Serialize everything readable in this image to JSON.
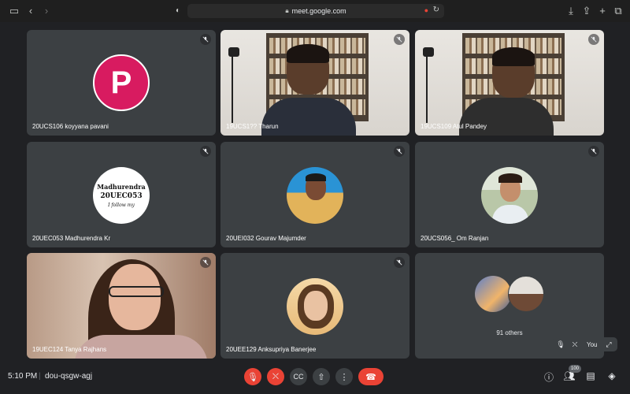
{
  "browser": {
    "url": "meet.google.com"
  },
  "tiles": [
    {
      "name": "20UCS106 koyyana pavani",
      "avatar_letter": "P",
      "avatar_color": "#d81b60",
      "muted": true
    },
    {
      "name": "19UCS1?? Tharun",
      "muted": true
    },
    {
      "name": "19UCS109 Atul Pandey",
      "muted": true
    },
    {
      "name": "20UEC053 Madhurendra Kr",
      "avatar_text": [
        "Madhurendra",
        "20UEC053",
        "I follow my"
      ],
      "muted": true
    },
    {
      "name": "20UEI032 Gourav Majumder",
      "muted": true
    },
    {
      "name": "20UCS056_ Om Ranjan",
      "muted": true
    },
    {
      "name": "19UEC124 Tanya Rajhans",
      "muted": true
    },
    {
      "name": "20UEE129 Anksupriya Banerjee",
      "muted": true
    },
    {
      "others_label": "91 others"
    }
  ],
  "self_view": {
    "label": "You"
  },
  "bottom_bar": {
    "time": "5:10 PM",
    "separator": "|",
    "meeting_code": "dou-qsgw-agj",
    "participants_badge": "100"
  },
  "colors": {
    "background": "#202124",
    "tile": "#3c4043",
    "danger": "#ea4335"
  }
}
